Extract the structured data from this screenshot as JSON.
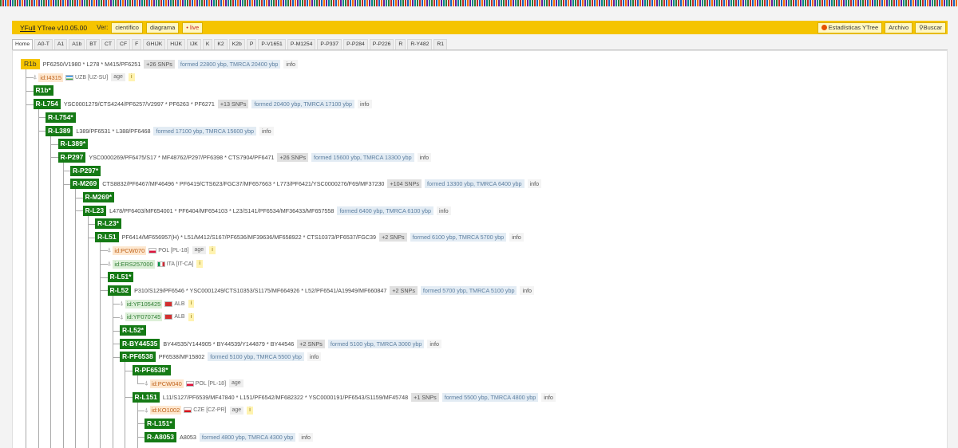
{
  "header": {
    "brand": "YFull",
    "version": "YTree v10.05.00",
    "view_label": "Ver:",
    "btn_cientifico": "científico",
    "btn_diagrama": "diagrama",
    "btn_live": "• live",
    "btn_estadisticas": "Estadísticas YTree",
    "btn_archivo": "Archivo",
    "btn_buscar": "Buscar"
  },
  "tabs": [
    "Home",
    "A0-T",
    "A1",
    "A1b",
    "BT",
    "CT",
    "CF",
    "F",
    "GHIJK",
    "HIJK",
    "IJK",
    "K",
    "K2",
    "K2b",
    "P",
    "P-V1651",
    "P-M1254",
    "P-P337",
    "P-P284",
    "P-P226",
    "R",
    "R-Y482",
    "R1"
  ],
  "colors": {
    "header_bg": "#f5c400",
    "haplogroup_bg": "#157a15",
    "root_bg": "#f5c400"
  },
  "tree": [
    {
      "depth": 0,
      "type": "node",
      "root": true,
      "label": "R1b",
      "snps": "PF6250/V1980 * L278 * M415/PF6251",
      "count": "+26 SNPs",
      "formed": "formed 22800 ybp, TMRCA 20400 ybp",
      "info": "info"
    },
    {
      "depth": 1,
      "type": "sample",
      "id": "id:I4315",
      "idc": "o",
      "flag": "uzb",
      "cc": "UZB [UZ-SU]",
      "age": "age",
      "i": "i"
    },
    {
      "depth": 1,
      "type": "node",
      "label": "R1b*"
    },
    {
      "depth": 1,
      "type": "node",
      "label": "R-L754",
      "snps": "YSC0001279/CTS4244/PF6257/V2997 * PF6263 * PF6271",
      "count": "+13 SNPs",
      "formed": "formed 20400 ybp, TMRCA 17100 ybp",
      "info": "info"
    },
    {
      "depth": 2,
      "type": "node",
      "label": "R-L754*"
    },
    {
      "depth": 2,
      "type": "node",
      "label": "R-L389",
      "snps": "L389/PF6531 * L388/PF6468",
      "formed": "formed 17100 ybp, TMRCA 15600 ybp",
      "info": "info"
    },
    {
      "depth": 3,
      "type": "node",
      "label": "R-L389*"
    },
    {
      "depth": 3,
      "type": "node",
      "label": "R-P297",
      "snps": "YSC0000269/PF6475/S17 * MF48762/P297/PF6398 * CTS7904/PF6471",
      "count": "+26 SNPs",
      "formed": "formed 15600 ybp, TMRCA 13300 ybp",
      "info": "info"
    },
    {
      "depth": 4,
      "type": "node",
      "label": "R-P297*"
    },
    {
      "depth": 4,
      "type": "node",
      "label": "R-M269",
      "snps": "CTS8832/PF6467/MF46496 * PF6419/CTS623/FGC37/MF657663 * L773/PF6421/YSC0000276/F69/MF37230",
      "count": "+104 SNPs",
      "formed": "formed 13300 ybp, TMRCA 6400 ybp",
      "info": "info"
    },
    {
      "depth": 5,
      "type": "node",
      "label": "R-M269*"
    },
    {
      "depth": 5,
      "type": "node",
      "label": "R-L23",
      "snps": "L478/PF6403/MF654001 * PF6404/MF654103 * L23/S141/PF6534/MF36433/MF657558",
      "formed": "formed 6400 ybp, TMRCA 6100 ybp",
      "info": "info"
    },
    {
      "depth": 6,
      "type": "node",
      "label": "R-L23*"
    },
    {
      "depth": 6,
      "type": "node",
      "label": "R-L51",
      "snps": "PF6414/MF656957(H) * L51/M412/S167/PF6536/MF39636/MF658922 * CTS10373/PF6537/FGC39",
      "count": "+2 SNPs",
      "formed": "formed 6100 ybp, TMRCA 5700 ybp",
      "info": "info"
    },
    {
      "depth": 7,
      "type": "sample",
      "id": "id:PCW070",
      "idc": "o",
      "flag": "pol",
      "cc": "POL [PL-18]",
      "age": "age",
      "i": "i"
    },
    {
      "depth": 7,
      "type": "sample",
      "id": "id:ERS257000",
      "idc": "g",
      "flag": "ita",
      "cc": "ITA [IT-CA]",
      "i": "i"
    },
    {
      "depth": 7,
      "type": "node",
      "label": "R-L51*"
    },
    {
      "depth": 7,
      "type": "node",
      "label": "R-L52",
      "snps": "P310/S129/PF6546 * YSC0001249/CTS10353/S1175/MF664926 * L52/PF6541/A19949/MF660847",
      "count": "+2 SNPs",
      "formed": "formed 5700 ybp, TMRCA 5100 ybp",
      "info": "info"
    },
    {
      "depth": 8,
      "type": "sample",
      "id": "id:YF105425",
      "idc": "g",
      "flag": "alb",
      "cc": "ALB",
      "i": "i"
    },
    {
      "depth": 8,
      "type": "sample",
      "id": "id:YF070745",
      "idc": "g",
      "flag": "alb",
      "cc": "ALB",
      "i": "i"
    },
    {
      "depth": 8,
      "type": "node",
      "label": "R-L52*"
    },
    {
      "depth": 8,
      "type": "node",
      "label": "R-BY44535",
      "snps": "BY44535/Y144905 * BY44539/Y144879 * BY44546",
      "count": "+2 SNPs",
      "formed": "formed 5100 ybp, TMRCA 3000 ybp",
      "info": "info"
    },
    {
      "depth": 8,
      "type": "node",
      "label": "R-PF6538",
      "snps": "PF6538/MF15802",
      "formed": "formed 5100 ybp, TMRCA 5500 ybp",
      "info": "info"
    },
    {
      "depth": 9,
      "type": "node",
      "label": "R-PF6538*"
    },
    {
      "depth": 10,
      "type": "sample",
      "id": "id:PCW040",
      "idc": "o",
      "flag": "pol",
      "cc": "POL [PL-18]",
      "age": "age"
    },
    {
      "depth": 9,
      "type": "node",
      "label": "R-L151",
      "snps": "L11/S127/PF6539/MF47840 * L151/PF6542/MF682322 * YSC0000191/PF6543/S1159/MF45748",
      "count": "+1 SNPs",
      "formed": "formed 5500 ybp, TMRCA 4800 ybp",
      "info": "info"
    },
    {
      "depth": 10,
      "type": "sample",
      "id": "id:KO1002",
      "idc": "o",
      "flag": "cze",
      "cc": "CZE [CZ-PR]",
      "age": "age",
      "i": "i"
    },
    {
      "depth": 10,
      "type": "node",
      "label": "R-L151*"
    },
    {
      "depth": 10,
      "type": "node",
      "label": "R-A8053",
      "snps": "A8053",
      "formed": "formed 4800 ybp, TMRCA 4300 ybp",
      "info": "info"
    }
  ]
}
